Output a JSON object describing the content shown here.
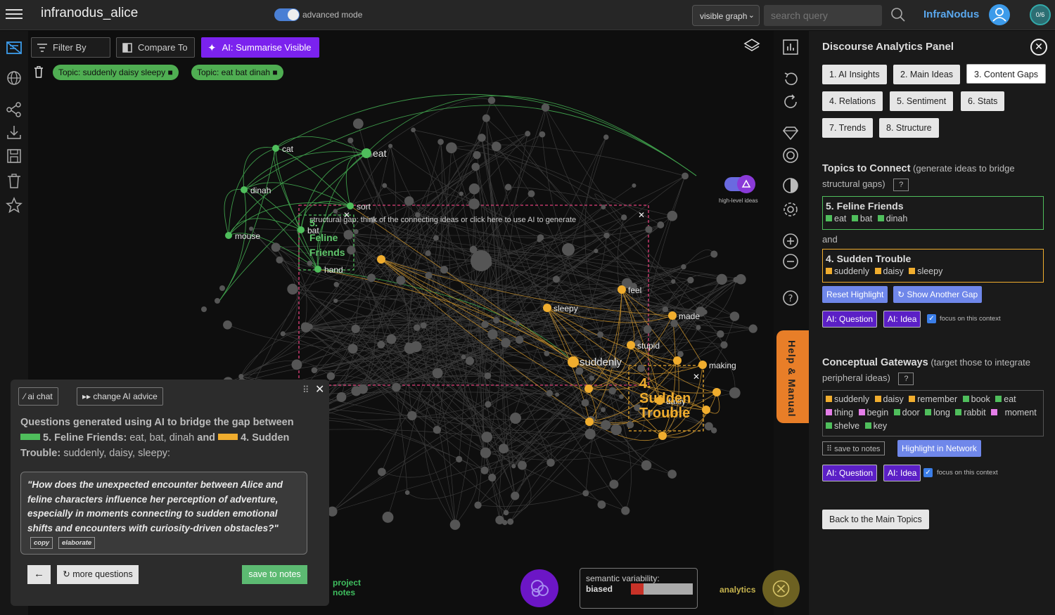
{
  "header": {
    "app_title": "infranodus_alice",
    "mode_label": "advanced mode",
    "graph_select": "visible graph",
    "search_placeholder": "search query",
    "brand": "InfraNodus",
    "count_badge": "0/6"
  },
  "toolbar": {
    "filter_label": "Filter By",
    "compare_label": "Compare To",
    "ai_label": "AI: Summarise Visible",
    "topics": [
      "Topic: suddenly daisy sleepy",
      "Topic: eat bat dinah"
    ]
  },
  "graph": {
    "high_level_label": "high-level ideas",
    "gap_text": "structural gap: think of the connecting ideas or click here to use AI to generate",
    "cluster_green": [
      "5.",
      "Feline",
      "Friends"
    ],
    "cluster_orange": [
      "4.",
      "Sudden",
      "Trouble"
    ],
    "node_labels": {
      "cat": "cat",
      "eat": "eat",
      "dinah": "dinah",
      "mouse": "mouse",
      "sort": "sort",
      "bat": "bat",
      "hand": "hand",
      "feel": "feel",
      "sleepy": "sleepy",
      "made": "made",
      "stupid": "stupid",
      "suddenly": "suddenly",
      "making": "making",
      "daisy": "daisy"
    }
  },
  "help_tab": "Help & Manual",
  "panel": {
    "title": "Discourse Analytics Panel",
    "tabs": [
      "1. AI Insights",
      "2. Main Ideas",
      "3. Content Gaps",
      "4. Relations",
      "5. Sentiment",
      "6. Stats",
      "7. Trends",
      "8. Structure"
    ],
    "connect_title": "Topics to Connect",
    "connect_sub": "(generate ideas to bridge structural gaps)",
    "qmark": "?",
    "topic_a": {
      "name": "5. Feline Friends",
      "words": [
        "eat",
        "bat",
        "dinah"
      ],
      "color": "#4fbe5c"
    },
    "and_label": "and",
    "topic_b": {
      "name": "4. Sudden Trouble",
      "words": [
        "suddenly",
        "daisy",
        "sleepy"
      ],
      "color": "#f0ad2e"
    },
    "reset_label": "Reset Highlight",
    "another_gap_label": "↻ Show Another Gap",
    "ai_question": "AI: Question",
    "ai_idea": "AI: Idea",
    "focus_label": "focus on this context",
    "gateways_title": "Conceptual Gateways",
    "gateways_sub": "(target those to integrate peripheral ideas)",
    "gateways": [
      {
        "w": "suddenly",
        "c": "#f0ad2e"
      },
      {
        "w": "daisy",
        "c": "#f0ad2e"
      },
      {
        "w": "remember",
        "c": "#f0ad2e"
      },
      {
        "w": "book",
        "c": "#4fbe5c"
      },
      {
        "w": "eat",
        "c": "#4fbe5c"
      },
      {
        "w": "thing",
        "c": "#e47ee8"
      },
      {
        "w": "begin",
        "c": "#e47ee8"
      },
      {
        "w": "door",
        "c": "#4fbe5c"
      },
      {
        "w": "long",
        "c": "#4fbe5c"
      },
      {
        "w": "rabbit",
        "c": "#4fbe5c"
      },
      {
        "w": "",
        "c": "#e47ee8"
      },
      {
        "w": "moment",
        "c": ""
      },
      {
        "w": "shelve",
        "c": "#4fbe5c"
      },
      {
        "w": "key",
        "c": "#4fbe5c"
      }
    ],
    "save_notes_label": "save to notes",
    "highlight_label": "Highlight in Network",
    "back_main_label": "Back to the Main Topics"
  },
  "chat": {
    "ai_chat_label": "ai chat",
    "advice_label": "change AI advice",
    "intro": "Questions generated using AI to bridge the gap between",
    "topic_a_name": "5. Feline Friends:",
    "topic_a_words": "eat, bat, dinah",
    "and_label": "and",
    "topic_b_name": "4. Sudden Trouble:",
    "topic_b_words": "suddenly, daisy, sleepy:",
    "question": "\"How does the unexpected encounter between Alice and feline characters influence her perception of adventure, especially in moments connecting to sudden emotional shifts and encounters with curiosity-driven obstacles?\"",
    "copy_label": "copy",
    "elaborate_label": "elaborate",
    "back_label": "←",
    "more_label": "↻ more questions",
    "save_label": "save to notes"
  },
  "bottom": {
    "project_notes": "project notes",
    "semantic_label": "semantic variability:",
    "semantic_value": "biased",
    "semantic_fraction": 0.2,
    "analytics_label": "analytics"
  }
}
